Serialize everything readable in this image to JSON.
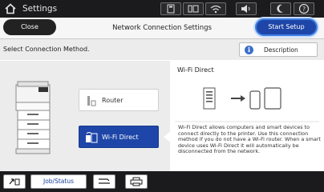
{
  "topbar": {
    "title": "Settings",
    "icons": [
      "home-icon",
      "memory-card-icon",
      "ethernet-status-icon",
      "wifi-status-icon",
      "volume-icon",
      "sleep-icon",
      "help-icon"
    ]
  },
  "subbar": {
    "close_label": "Close",
    "title": "Network Connection Settings",
    "start_label": "Start Setup"
  },
  "select": {
    "label": "Select Connection Method.",
    "description_label": "Description"
  },
  "options": {
    "router_label": "Router",
    "wifi_direct_label": "Wi-Fi Direct",
    "selected": "Wi-Fi Direct"
  },
  "detail": {
    "title": "Wi-Fi Direct",
    "description": "Wi-Fi Direct allows computers and smart devices to connect directly to the printer. Use this connection method if you do not have a Wi-Fi router. When a smart device uses Wi-Fi Direct it will automatically be disconnected from the network."
  },
  "bottombar": {
    "job_status_label": "Job/Status",
    "icons": [
      "wifi-direct-connect-icon",
      "stop-icon",
      "printer-icon"
    ]
  },
  "colors": {
    "accent": "#1e46a8",
    "header": "#1b1b1d",
    "panel": "#ececec"
  }
}
